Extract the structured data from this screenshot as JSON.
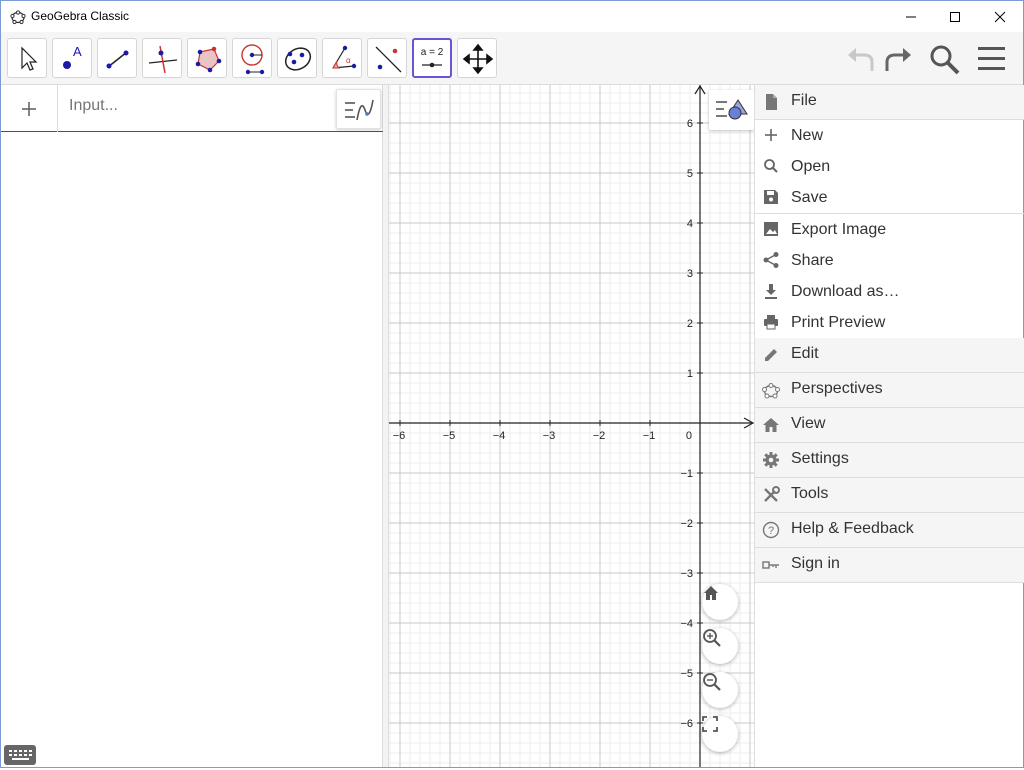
{
  "window": {
    "title": "GeoGebra Classic"
  },
  "toolbar": {
    "slider_tool_label": "a = 2",
    "tools": [
      "move-tool",
      "point-tool",
      "line-tool",
      "perpendicular-line-tool",
      "polygon-tool",
      "circle-tool",
      "conic-tool",
      "angle-tool",
      "reflect-tool",
      "slider-tool",
      "move-graphics-view-tool"
    ]
  },
  "algebra": {
    "input_placeholder": "Input..."
  },
  "graphics": {
    "x_ticks": [
      "−6",
      "−5",
      "−4",
      "−3",
      "−2",
      "−1",
      "0"
    ],
    "y_ticks": [
      "6",
      "5",
      "4",
      "3",
      "2",
      "1",
      "−1",
      "−2",
      "−3",
      "−4",
      "−5",
      "−6"
    ]
  },
  "menu": {
    "file": "File",
    "file_items": {
      "new": "New",
      "open": "Open",
      "save": "Save",
      "export_image": "Export Image",
      "share": "Share",
      "download_as": "Download as…",
      "print_preview": "Print Preview"
    },
    "edit": "Edit",
    "perspectives": "Perspectives",
    "view": "View",
    "settings": "Settings",
    "tools": "Tools",
    "help_feedback": "Help & Feedback",
    "sign_in": "Sign in"
  },
  "colors": {
    "accent": "#6557d2",
    "point_blue": "#1a1aa6",
    "red": "#cc3333"
  }
}
